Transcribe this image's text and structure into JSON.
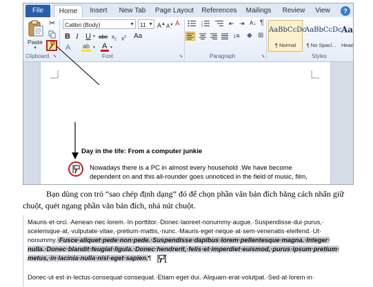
{
  "ribbon": {
    "tabs": [
      "File",
      "Home",
      "Insert",
      "New Tab",
      "Page Layout",
      "References",
      "Mailings",
      "Review",
      "View"
    ],
    "help_icon": "?",
    "clipboard": {
      "paste_label": "Paste",
      "group_label": "Clipboard"
    },
    "font": {
      "family_value": "Calibri (Body)",
      "size_value": "11",
      "group_label": "Font"
    },
    "paragraph": {
      "group_label": "Paragraph"
    },
    "styles": {
      "items": [
        {
          "sample": "AaBbCcDc",
          "name": "¶ Normal"
        },
        {
          "sample": "AaBbCcDc",
          "name": "¶ No Spaci..."
        },
        {
          "sample": "AaB",
          "name": "Headin"
        }
      ],
      "group_label": "Styles"
    }
  },
  "document1": {
    "heading": "Day in the life: From a computer junkie",
    "lines": [
      "Nowadays there is a PC in almost every household .We have become",
      "dependent on and this all-rounder goes unnoticed in the field of music, film,"
    ]
  },
  "caption": "Bạn dùng con trỏ “sao chép định dạng” đó để chọn phần văn bản đích bằng cách nhấn giữ chuột, quét ngang phần văn bản đích, nhả nút chuột.",
  "document2": {
    "line1": "Mauris·et·orci.·Aenean·nec·lorem.·In·porttitor.·Donec·laoreet·nonummy·augue.·Suspendisse·dui·purus,·",
    "line2": "scelerisque·at,·vulputate·vitae,·pretium·mattis,·nunc.·Mauris·eget·neque·at·sem·venenatis·eleifend.·Ut·",
    "line3_plain": "nonummy.",
    "line3_selected": "·Fusce·aliquet·pede·non·pede.·Suspendisse·dapibus·lorem·pellentesque·magna.·Integer·",
    "line4_selected": "nulla.·Donec·blandit·feugiat·ligula.·Donec·hendrerit,·felis·et·imperdiet·euismod,·purus·ipsum·pretium·",
    "line5_selected": "metus,·in·lacinia·nulla·nisl·eget·sapien.",
    "pilcrow": "¶",
    "line6": "Donec·ut·est·in·lectus·consequat·consequat.·Etiam·eget·dui.·Aliquam·erat·volutpat.·Sed·at·lorem·in·"
  },
  "colors": {
    "accent": "#2a5ea8",
    "highlight": "#ffe600",
    "font_red": "#e01010",
    "annotation_red": "#d4141b",
    "selection": "#c9cdd3"
  }
}
